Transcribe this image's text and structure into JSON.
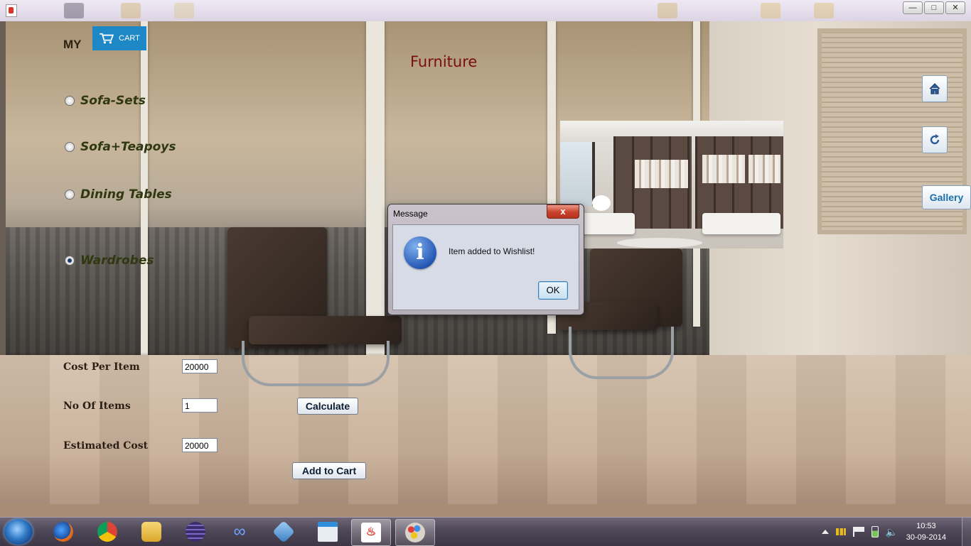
{
  "window": {
    "title": "",
    "controls": [
      "minimize-icon",
      "maximize-icon",
      "close-icon"
    ]
  },
  "header": {
    "my_label": "MY",
    "cart_label": "CART",
    "page_title": "Furniture"
  },
  "categories": [
    {
      "label": "Sofa-Sets",
      "selected": false
    },
    {
      "label": "Sofa+Teapoys",
      "selected": false
    },
    {
      "label": "Dining Tables",
      "selected": false
    },
    {
      "label": "Wardrobes",
      "selected": true
    }
  ],
  "form": {
    "cost_per_item_label": "Cost Per Item",
    "cost_per_item_value": "20000",
    "no_of_items_label": "No Of Items",
    "no_of_items_value": "1",
    "estimated_cost_label": "Estimated Cost",
    "estimated_cost_value": "20000",
    "calculate_label": "Calculate",
    "add_to_cart_label": "Add to Cart"
  },
  "side_nav": {
    "home_icon": "home-icon",
    "refresh_icon": "refresh-icon",
    "gallery_label": "Gallery"
  },
  "dialog": {
    "title": "Message",
    "close_label": "x",
    "message": "Item added to Wishlist!",
    "ok_label": "OK",
    "icon": "info-icon"
  },
  "taskbar": {
    "apps": [
      "firefox-icon",
      "chrome-icon",
      "file-explorer-icon",
      "eclipse-icon",
      "visual-studio-icon",
      "virtualbox-icon",
      "app-window-icon",
      "java-icon",
      "paint-icon"
    ],
    "active_apps": [
      "java-icon",
      "paint-icon"
    ],
    "time": "10:53",
    "date": "30-09-2014"
  },
  "colors": {
    "cart_blue": "#1e88c7",
    "title_red": "#7a0f12",
    "gallery_text": "#1a6fae",
    "radio_label": "#303810"
  }
}
